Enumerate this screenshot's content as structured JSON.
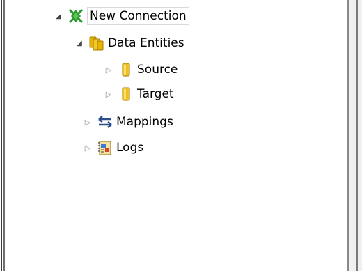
{
  "tree": {
    "root": {
      "label": "New Connection",
      "icon": "connection-plug-icon",
      "expanded": true,
      "children": [
        {
          "label": "Data Entities",
          "icon": "data-entities-icon",
          "expanded": true,
          "children": [
            {
              "label": "Source",
              "icon": "entity-cylinder-icon",
              "expanded": false
            },
            {
              "label": "Target",
              "icon": "entity-cylinder-icon",
              "expanded": false
            }
          ]
        },
        {
          "label": "Mappings",
          "icon": "mappings-arrows-icon",
          "expanded": false
        },
        {
          "label": "Logs",
          "icon": "logs-notebook-icon",
          "expanded": false
        }
      ]
    }
  },
  "colors": {
    "connection_icon": "#2e9a2e",
    "entity_icon": "#e8b400",
    "mappings_icon": "#2b4e8c",
    "frame_border": "#6f6f6f"
  }
}
